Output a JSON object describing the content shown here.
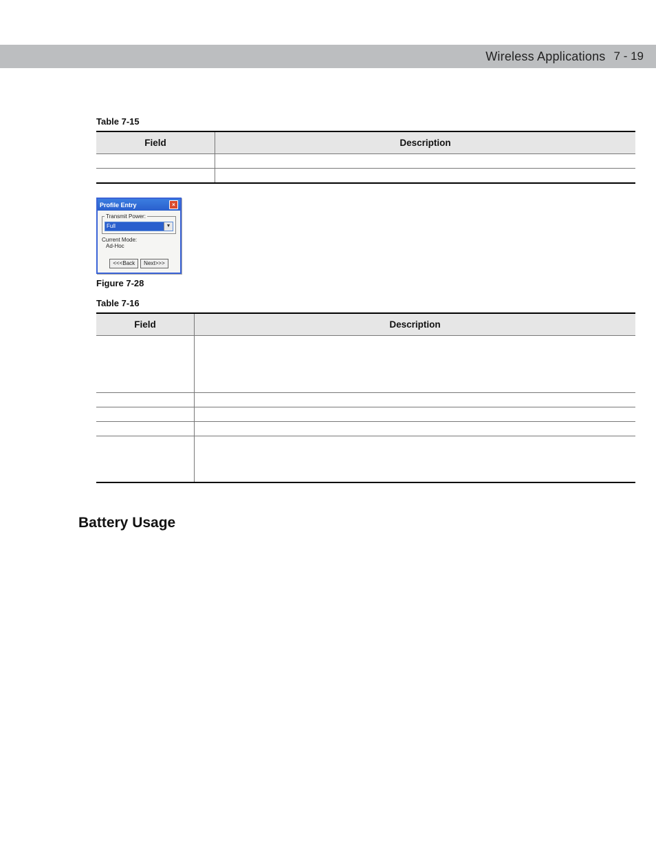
{
  "header": {
    "chapter_title": "Wireless Applications",
    "page_indicator": "7 - 19"
  },
  "table15": {
    "caption_strong": "Table 7-15",
    "caption_rest": "",
    "headers": [
      "Field",
      "Description"
    ],
    "rows": [
      {
        "field": "",
        "desc": ""
      },
      {
        "field": "",
        "desc": ""
      }
    ]
  },
  "figure28": {
    "caption_strong": "Figure 7-28",
    "caption_rest": "",
    "window_title": "Profile Entry",
    "close_glyph": "×",
    "group_legend": "Transmit Power:",
    "dropdown_value": "Full",
    "mode_label": "Current Mode:",
    "mode_value": "Ad-Hoc",
    "back_label": "<<<Back",
    "next_label": "Next>>>"
  },
  "table16": {
    "caption_strong": "Table 7-16",
    "caption_rest": "",
    "headers": [
      "Field",
      "Description"
    ],
    "rows": [
      {
        "field": "",
        "desc": ""
      },
      {
        "field": "",
        "desc": ""
      },
      {
        "field": "",
        "desc": ""
      },
      {
        "field": "",
        "desc": ""
      },
      {
        "field": "",
        "desc": ""
      }
    ]
  },
  "section_heading": "Battery Usage"
}
